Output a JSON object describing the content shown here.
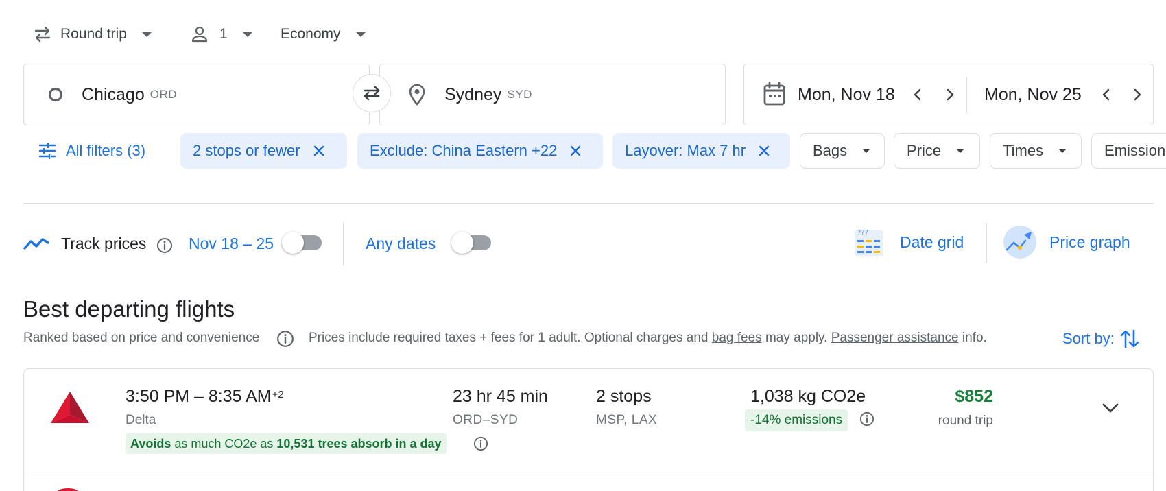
{
  "trip": {
    "type_label": "Round trip",
    "passengers": "1",
    "cabin": "Economy"
  },
  "search": {
    "origin_city": "Chicago",
    "origin_code": "ORD",
    "dest_city": "Sydney",
    "dest_code": "SYD",
    "depart_date": "Mon, Nov 18",
    "return_date": "Mon, Nov 25"
  },
  "filters": {
    "all_filters": "All filters (3)",
    "chips_active": [
      "2 stops or fewer",
      "Exclude: China Eastern +22",
      "Layover: Max 7 hr"
    ],
    "chips": [
      "Bags",
      "Price",
      "Times",
      "Emissions"
    ]
  },
  "track": {
    "label": "Track prices",
    "dates": "Nov 18 – 25",
    "any_dates": "Any dates",
    "date_grid": "Date grid",
    "price_graph": "Price graph"
  },
  "results": {
    "title": "Best departing flights",
    "ranked": "Ranked based on price and convenience",
    "prices_note_1": "Prices include required taxes + fees for 1 adult. Optional charges and",
    "bag_fees": "bag fees",
    "prices_note_2": "may apply.",
    "passenger_assistance": "Passenger assistance",
    "prices_note_3": "info.",
    "sort_by": "Sort by:"
  },
  "flights": [
    {
      "times": "3:50 PM – 8:35 AM",
      "day_offset": "+2",
      "airline": "Delta",
      "duration": "23 hr 45 min",
      "route": "ORD–SYD",
      "stops": "2 stops",
      "stops_via": "MSP, LAX",
      "emissions": "1,038 kg CO2e",
      "emissions_delta": "-14% emissions",
      "price": "$852",
      "price_type": "round trip",
      "eco_avoids": "Avoids",
      "eco_mid": "as much CO2e as",
      "eco_trees": "10,531 trees absorb in a day"
    }
  ],
  "colors": {
    "accent": "#1a73e8",
    "chip_bg": "#e8f0fe",
    "price_green": "#188038",
    "eco_bg": "#e6f4ea",
    "delta_red": "#c8102e"
  }
}
